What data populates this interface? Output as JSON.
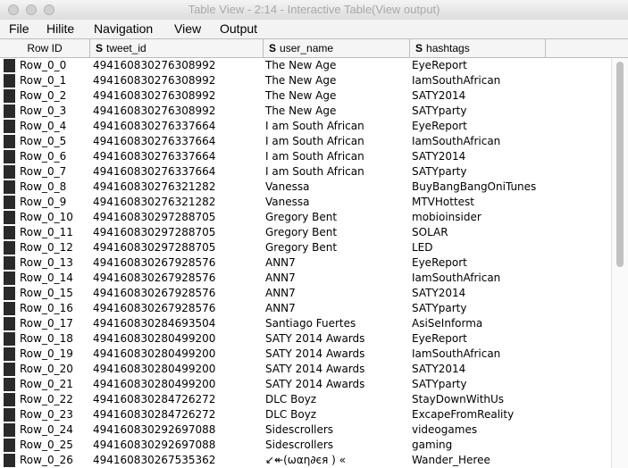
{
  "window": {
    "title": "Table View - 2:14 - Interactive Table(View output)"
  },
  "menu": [
    "File",
    "Hilite",
    "Navigation",
    "View",
    "Output"
  ],
  "columns": [
    {
      "label": "Row ID",
      "type": ""
    },
    {
      "label": "tweet_id",
      "type": "S"
    },
    {
      "label": "user_name",
      "type": "S"
    },
    {
      "label": "hashtags",
      "type": "S"
    }
  ],
  "rows": [
    [
      "Row_0_0",
      "494160830276308992",
      "The New Age",
      "EyeReport"
    ],
    [
      "Row_0_1",
      "494160830276308992",
      "The New Age",
      "IamSouthAfrican"
    ],
    [
      "Row_0_2",
      "494160830276308992",
      "The New Age",
      "SATY2014"
    ],
    [
      "Row_0_3",
      "494160830276308992",
      "The New Age",
      "SATYparty"
    ],
    [
      "Row_0_4",
      "494160830276337664",
      "I am South African",
      "EyeReport"
    ],
    [
      "Row_0_5",
      "494160830276337664",
      "I am South African",
      "IamSouthAfrican"
    ],
    [
      "Row_0_6",
      "494160830276337664",
      "I am South African",
      "SATY2014"
    ],
    [
      "Row_0_7",
      "494160830276337664",
      "I am South African",
      "SATYparty"
    ],
    [
      "Row_0_8",
      "494160830276321282",
      "Vanessa",
      "BuyBangBangOniTunes"
    ],
    [
      "Row_0_9",
      "494160830276321282",
      "Vanessa",
      "MTVHottest"
    ],
    [
      "Row_0_10",
      "494160830297288705",
      "Gregory Bent",
      "mobioinsider"
    ],
    [
      "Row_0_11",
      "494160830297288705",
      "Gregory Bent",
      "SOLAR"
    ],
    [
      "Row_0_12",
      "494160830297288705",
      "Gregory Bent",
      "LED"
    ],
    [
      "Row_0_13",
      "494160830267928576",
      "ANN7",
      "EyeReport"
    ],
    [
      "Row_0_14",
      "494160830267928576",
      "ANN7",
      "IamSouthAfrican"
    ],
    [
      "Row_0_15",
      "494160830267928576",
      "ANN7",
      "SATY2014"
    ],
    [
      "Row_0_16",
      "494160830267928576",
      "ANN7",
      "SATYparty"
    ],
    [
      "Row_0_17",
      "494160830284693504",
      "Santiago Fuertes",
      "AsiSeInforma"
    ],
    [
      "Row_0_18",
      "494160830280499200",
      "SATY 2014 Awards",
      "EyeReport"
    ],
    [
      "Row_0_19",
      "494160830280499200",
      "SATY 2014 Awards",
      "IamSouthAfrican"
    ],
    [
      "Row_0_20",
      "494160830280499200",
      "SATY 2014 Awards",
      "SATY2014"
    ],
    [
      "Row_0_21",
      "494160830280499200",
      "SATY 2014 Awards",
      "SATYparty"
    ],
    [
      "Row_0_22",
      "494160830284726272",
      "DLC Boyz",
      "StayDownWithUs"
    ],
    [
      "Row_0_23",
      "494160830284726272",
      "DLC Boyz",
      "ExcapeFromReality"
    ],
    [
      "Row_0_24",
      "494160830292697088",
      "Sidescrollers",
      "videogames"
    ],
    [
      "Row_0_25",
      "494160830292697088",
      "Sidescrollers",
      "gaming"
    ],
    [
      "Row_0_26",
      "494160830267535362",
      "↙↞(ωαη∂єя ) «",
      "Wander_Heree"
    ]
  ],
  "colors": {
    "row_marker": "#2a2a2a",
    "header_bg": "#f5f5f5",
    "title_text": "#a8a8a8"
  }
}
